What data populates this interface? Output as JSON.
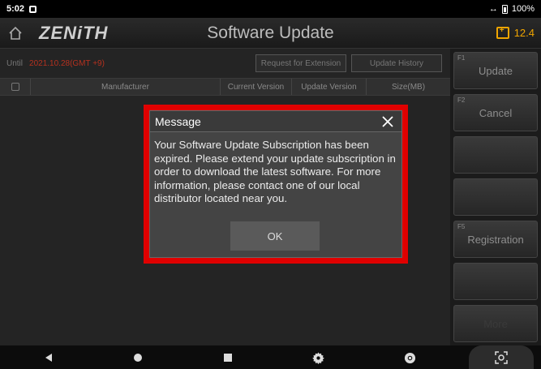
{
  "status_bar": {
    "time": "5:02",
    "battery": "100%"
  },
  "header": {
    "brand": "ZENiTH",
    "title": "Software Update",
    "battery_voltage": "12.4"
  },
  "subscription": {
    "until_label": "Until",
    "until_date": "2021.10.28(GMT +9)"
  },
  "toolbar": {
    "request_extension": "Request for Extension",
    "update_history": "Update History"
  },
  "table": {
    "columns": [
      "Manufacturer",
      "Current Version",
      "Update Version",
      "Size(MB)"
    ]
  },
  "side_buttons": [
    {
      "fkey": "F1",
      "label": "Update"
    },
    {
      "fkey": "F2",
      "label": "Cancel"
    },
    {
      "fkey": "",
      "label": ""
    },
    {
      "fkey": "",
      "label": ""
    },
    {
      "fkey": "F5",
      "label": "Registration"
    },
    {
      "fkey": "",
      "label": ""
    },
    {
      "fkey": "",
      "label": "More"
    }
  ],
  "dialog": {
    "title": "Message",
    "message": "Your Software Update Subscription has been expired. Please extend your update subscription in order to download the latest software. For more information, please contact one of our local distributor located near you.",
    "ok_label": "OK"
  },
  "colors": {
    "highlight": "#e00000",
    "accent": "#f0a500",
    "date": "#b5311f"
  }
}
